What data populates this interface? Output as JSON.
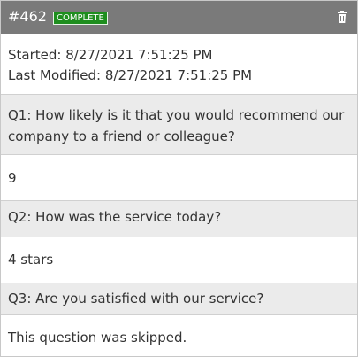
{
  "response": {
    "id": "#462",
    "status": "COMPLETE",
    "started": "Started: 8/27/2021 7:51:25 PM",
    "last_modified": "Last Modified: 8/27/2021 7:51:25 PM"
  },
  "delete_icon": "trash-icon",
  "questions": [
    {
      "question": "Q1: How likely is it that you would recommend our company to a friend or colleague?",
      "answer": "9"
    },
    {
      "question": "Q2: How was the service today?",
      "answer": "4 stars"
    },
    {
      "question": "Q3: Are you satisfied with our service?",
      "answer": "This question was skipped."
    }
  ],
  "colors": {
    "header_bg": "#7a7a7a",
    "status_green": "#1e8e1e",
    "question_bg": "#ebebeb"
  }
}
